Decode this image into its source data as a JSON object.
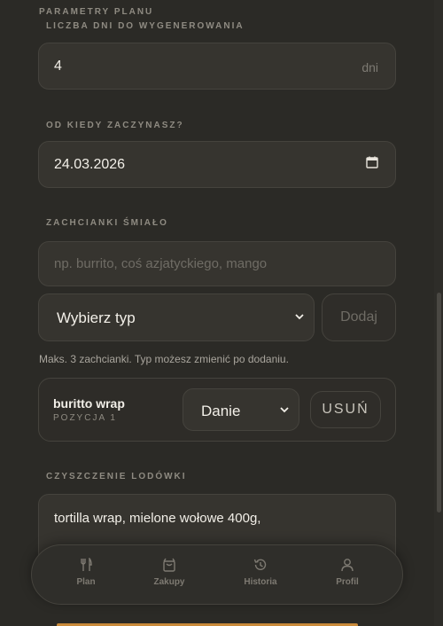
{
  "section": {
    "title": "PARAMETRY PLANU"
  },
  "days": {
    "label": "LICZBA DNI DO WYGENEROWANIA",
    "value": "4",
    "unit": "dni"
  },
  "start": {
    "label": "OD KIEDY ZACZYNASZ?",
    "value": "24.03.2026",
    "icon": "calendar-icon"
  },
  "cravings": {
    "label": "ZACHCIANKI ŚMIAŁO",
    "placeholder": "np. burrito, coś azjatyckiego, mango",
    "type_select": "Wybierz typ",
    "add_label": "Dodaj",
    "hint": "Maks. 3 zachcianki. Typ możesz zmienić po dodaniu.",
    "items": [
      {
        "name": "buritto wrap",
        "position": "POZYCJA 1",
        "type": "Danie",
        "remove_label": "USUŃ"
      }
    ]
  },
  "fridge": {
    "label": "CZYSZCZENIE LODÓWKI",
    "value": "tortilla wrap, mielone wołowe 400g,"
  },
  "nav": {
    "items": [
      {
        "label": "Plan",
        "icon": "fork-knife-icon"
      },
      {
        "label": "Zakupy",
        "icon": "shopping-bag-icon"
      },
      {
        "label": "Historia",
        "icon": "history-icon"
      },
      {
        "label": "Profil",
        "icon": "user-icon"
      }
    ]
  },
  "colors": {
    "background": "#2b2a26",
    "field": "#36342f",
    "accent": "#c98a3a"
  }
}
